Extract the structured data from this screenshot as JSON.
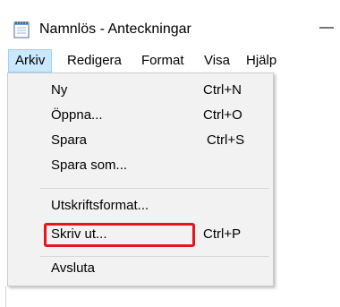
{
  "window": {
    "title": "Namnlös - Anteckningar",
    "minimize_symbol": "—",
    "icon": "notepad-icon"
  },
  "menubar": {
    "items": [
      {
        "label": "Arkiv",
        "active": true
      },
      {
        "label": "Redigera",
        "active": false
      },
      {
        "label": "Format",
        "active": false
      },
      {
        "label": "Visa",
        "active": false
      },
      {
        "label": "Hjälp",
        "active": false
      }
    ]
  },
  "file_menu": {
    "items": [
      {
        "label": "Ny",
        "shortcut": "Ctrl+N"
      },
      {
        "label": "Öppna...",
        "shortcut": "Ctrl+O"
      },
      {
        "label": "Spara",
        "shortcut": "Ctrl+S"
      },
      {
        "label": "Spara som...",
        "shortcut": ""
      },
      {
        "label": "Utskriftsformat...",
        "shortcut": ""
      },
      {
        "label": "Skriv ut...",
        "shortcut": "Ctrl+P",
        "highlighted": true
      },
      {
        "label": "Avsluta",
        "shortcut": ""
      }
    ]
  },
  "colors": {
    "menu_active_bg": "#cce8ff",
    "menu_active_border": "#99d1ff",
    "dropdown_bg": "#f2f2f2",
    "highlight_border": "#e8141b"
  }
}
